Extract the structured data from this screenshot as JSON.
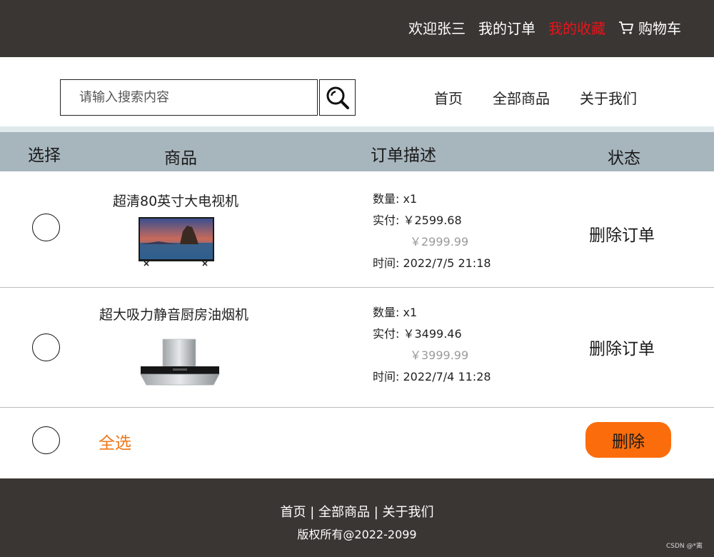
{
  "topbar": {
    "welcome": "欢迎张三",
    "my_orders": "我的订单",
    "my_favorites": "我的收藏",
    "cart_icon": "cart-icon",
    "cart": "购物车",
    "active_color": "#e8141b"
  },
  "header": {
    "search_placeholder": "请输入搜索内容",
    "search_icon": "search-icon",
    "nav": [
      "首页",
      "全部商品",
      "关于我们"
    ]
  },
  "table": {
    "columns": [
      "选择",
      "商品",
      "订单描述",
      "状态"
    ],
    "rows": [
      {
        "name": "超清80英寸大电视机",
        "image_icon": "tv-image",
        "qty_label": "数量:",
        "qty": "x1",
        "paid_label": "实付:",
        "paid": "￥2599.68",
        "original_price": "￥2999.99",
        "time_label": "时间:",
        "time": "2022/7/5  21:18",
        "action": "删除订单"
      },
      {
        "name": "超大吸力静音厨房油烟机",
        "image_icon": "range-hood-image",
        "qty_label": "数量:",
        "qty": "x1",
        "paid_label": "实付:",
        "paid": "￥3499.46",
        "original_price": "￥3999.99",
        "time_label": "时间:",
        "time": "2022/7/4  11:28",
        "action": "删除订单"
      }
    ]
  },
  "bottom": {
    "select_all": "全选",
    "delete": "删除",
    "accent_color": "#fb6d0c"
  },
  "footer": {
    "links": "首页 | 全部商品 | 关于我们",
    "copyright": "版权所有@2022-2099",
    "watermark": "CSDN @*离"
  }
}
